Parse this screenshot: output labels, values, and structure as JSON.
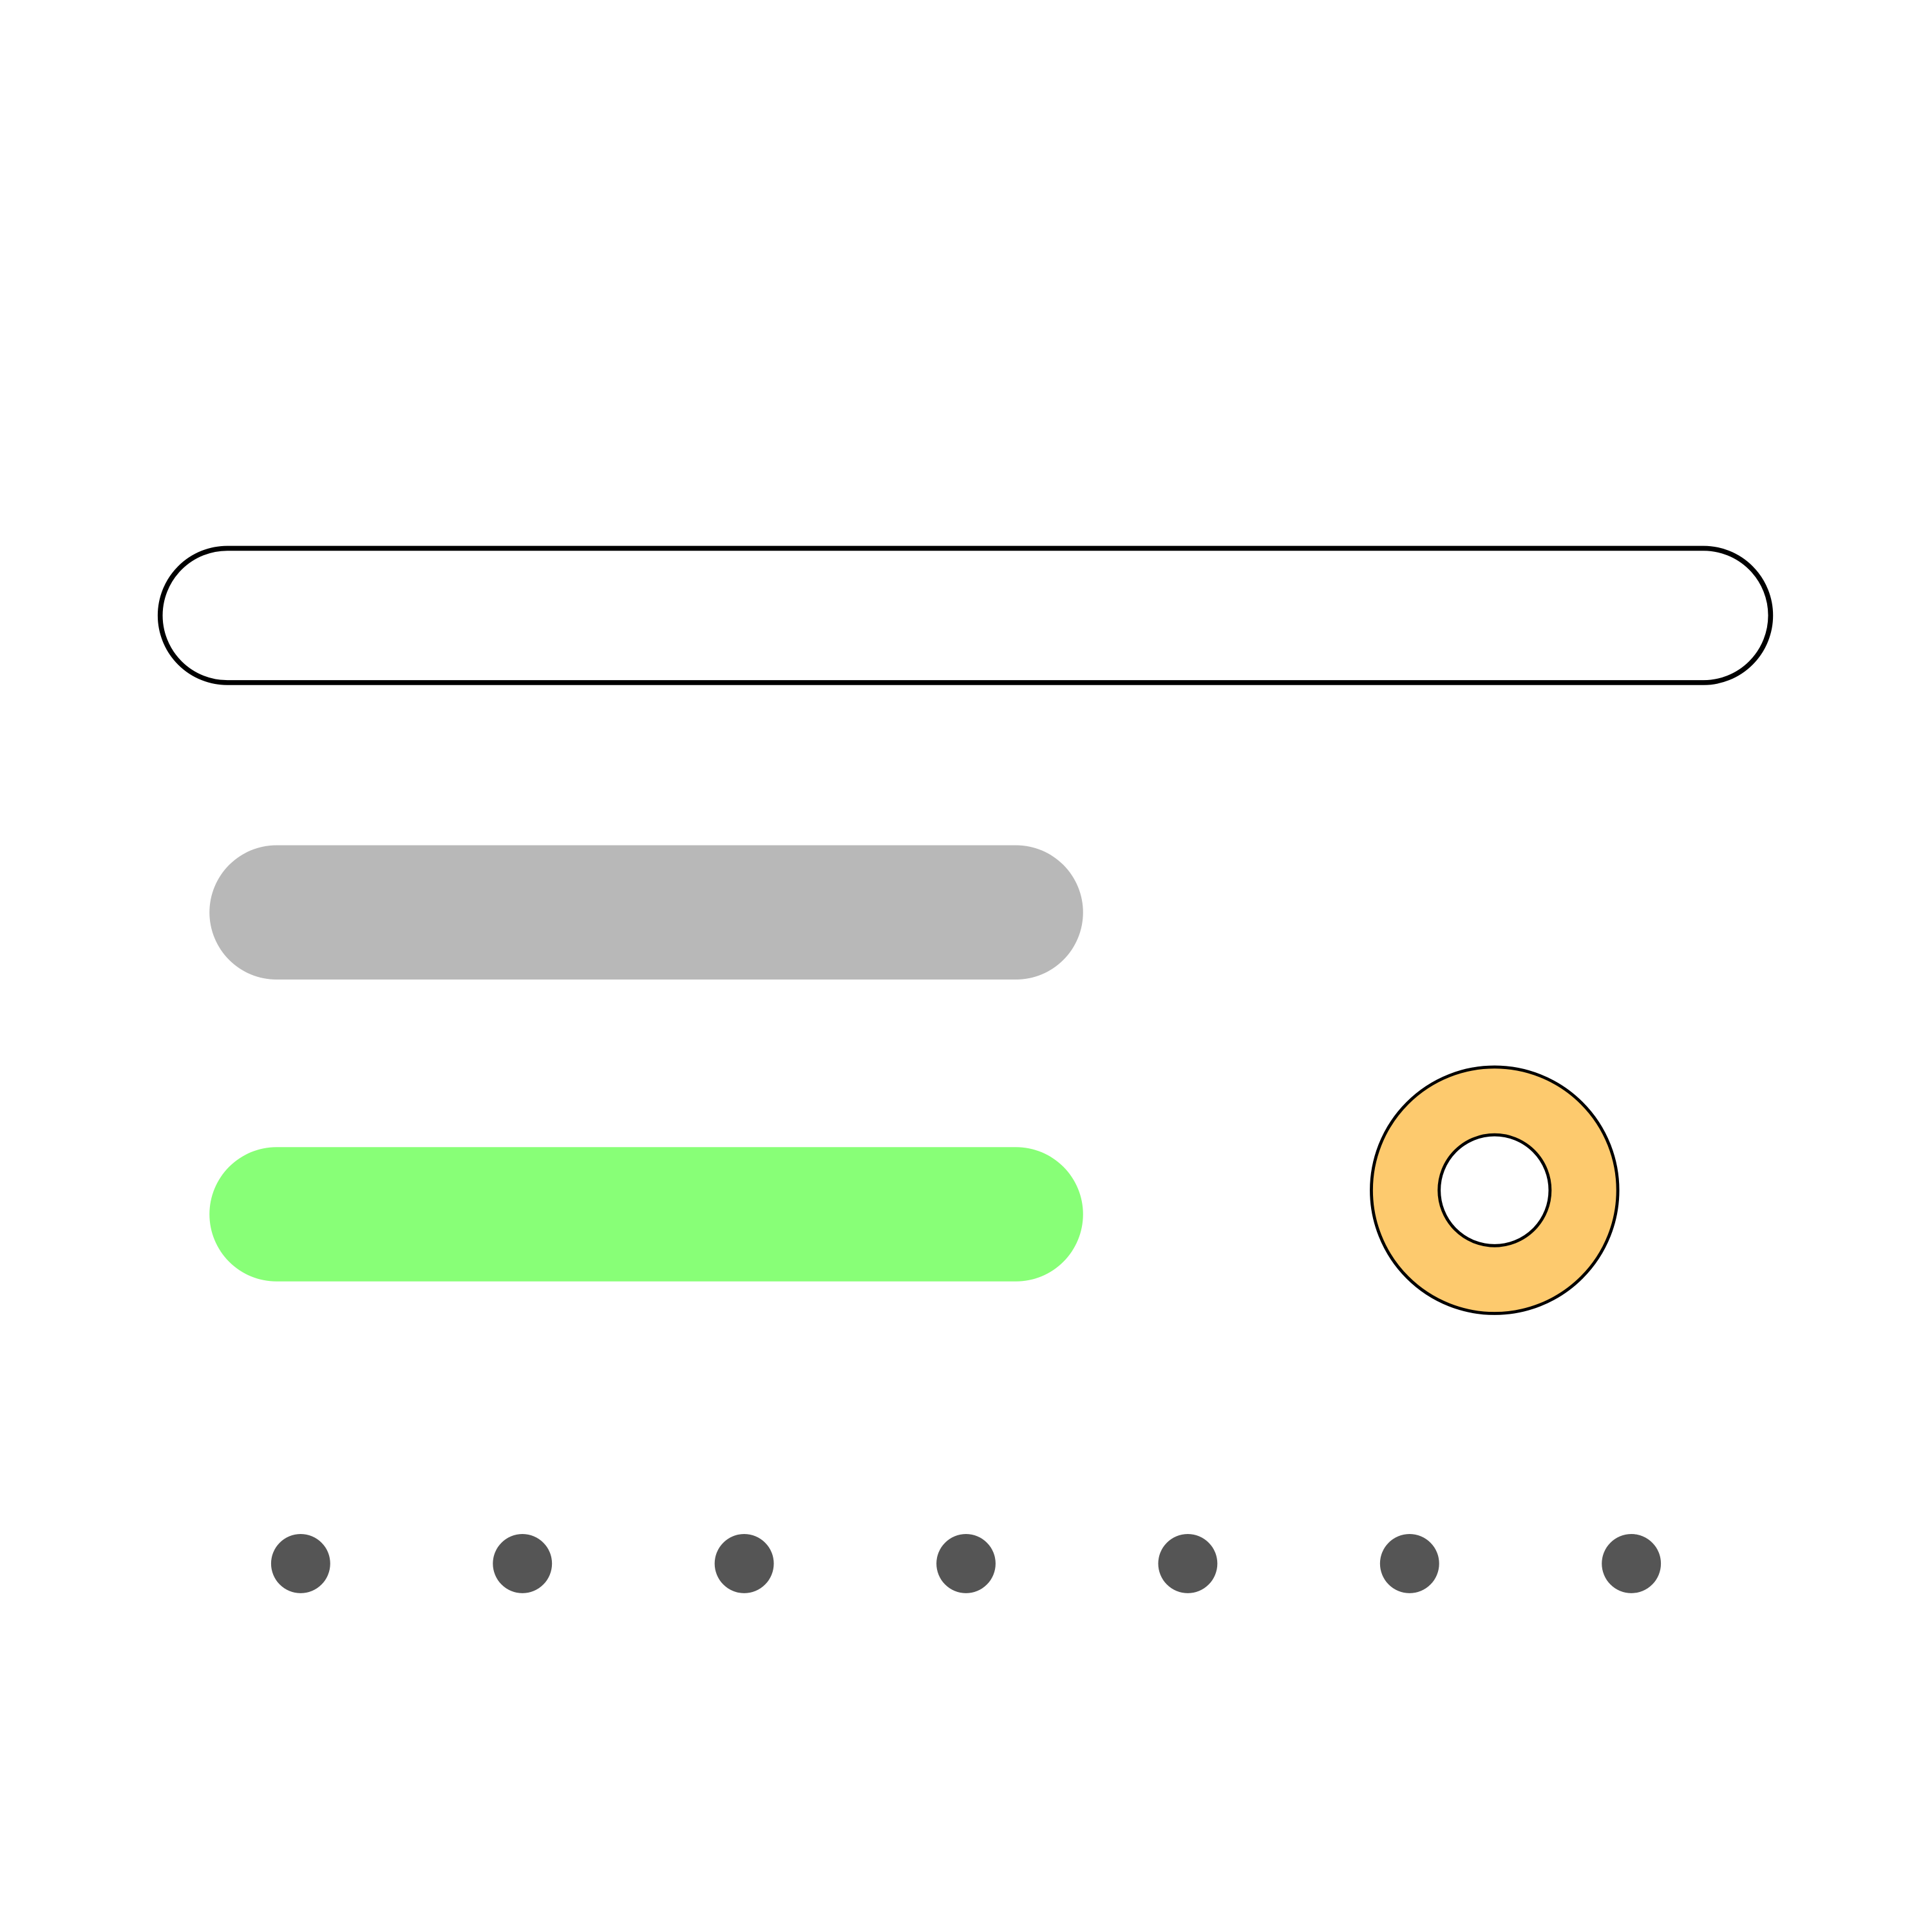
{
  "colors": {
    "background": "#ffffff",
    "outline": "#000000",
    "gray_bar": "#b8b8b8",
    "green_bar": "#88ff77",
    "ring": "#fdca6e",
    "ring_hole": "#ffffff",
    "dot": "#555555"
  },
  "shapes": {
    "outlined_bar": "outlined-pill",
    "gray_bar": "filled-pill",
    "green_bar": "filled-pill",
    "ring": "ring",
    "dots": "dot-row"
  },
  "dot_count": 7
}
